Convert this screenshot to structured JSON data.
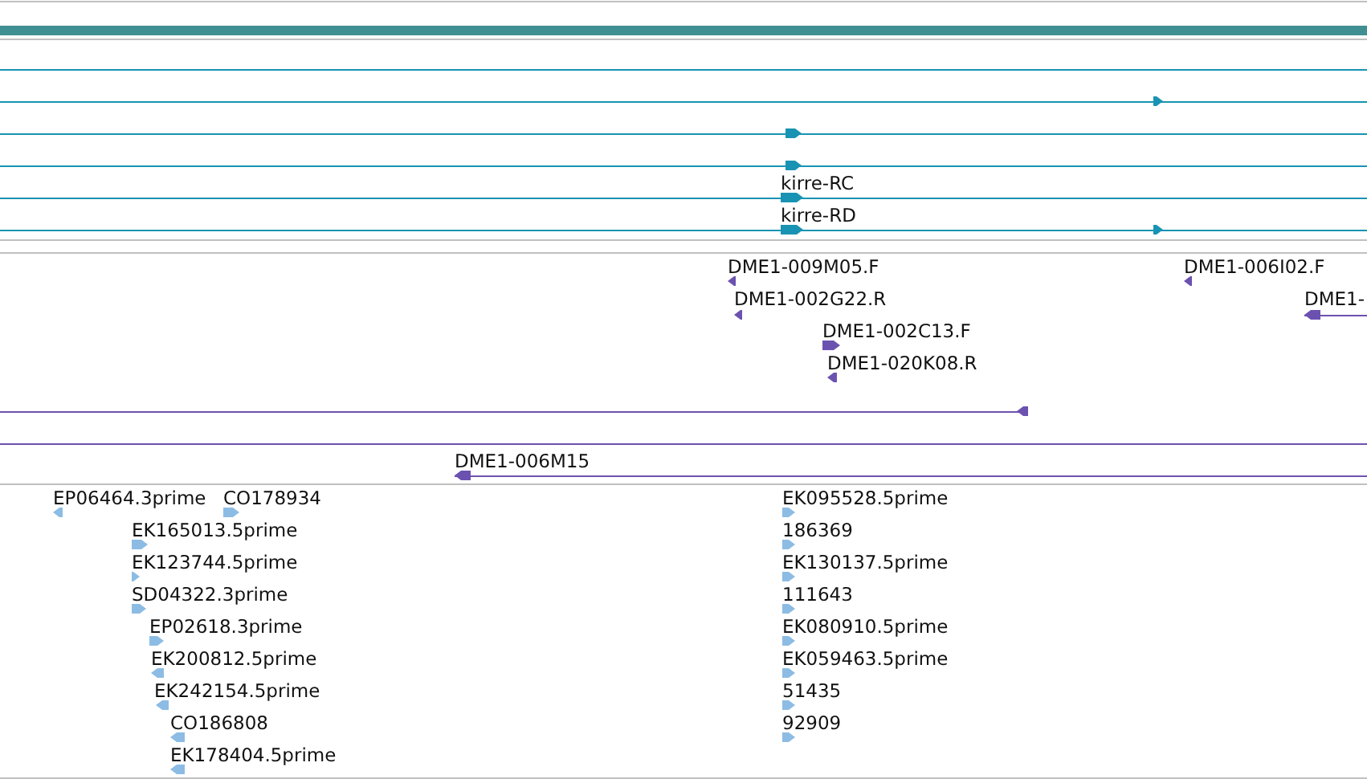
{
  "gene_track": {
    "transcripts": [
      {
        "kind": "line"
      },
      {
        "kind": "arrow",
        "reverse": false
      },
      {
        "kind": "arrow",
        "reverse": false
      },
      {
        "kind": "arrow",
        "reverse": false
      },
      {
        "kind": "arrow",
        "label": "kirre-RC",
        "reverse": false
      },
      {
        "kind": "arrow",
        "label": "kirre-RD",
        "reverse": false
      }
    ]
  },
  "clone_track": {
    "features": [
      {
        "kind": "arrow",
        "label": "DME1-009M05.F",
        "reverse": true
      },
      {
        "kind": "arrow",
        "label": "DME1-002G22.R",
        "reverse": true
      },
      {
        "kind": "arrow",
        "label": "DME1-002C13.F",
        "reverse": false
      },
      {
        "kind": "arrow",
        "label": "DME1-020K08.R",
        "reverse": true
      },
      {
        "kind": "arrow",
        "label": "DME1-006I02.F",
        "reverse": true
      },
      {
        "kind": "arrow",
        "label": "DME1-",
        "reverse": true
      },
      {
        "kind": "arrow",
        "reverse": true
      },
      {
        "kind": "line"
      },
      {
        "kind": "arrow",
        "label": "DME1-006M15",
        "reverse": true
      }
    ]
  },
  "est_track": {
    "features": [
      {
        "label": "EP06464.3prime",
        "reverse": true
      },
      {
        "label": "CO178934",
        "reverse": false
      },
      {
        "label": "EK165013.5prime",
        "reverse": false
      },
      {
        "label": "EK123744.5prime",
        "reverse": false
      },
      {
        "label": "SD04322.3prime",
        "reverse": false
      },
      {
        "label": "EP02618.3prime",
        "reverse": false
      },
      {
        "label": "EK200812.5prime",
        "reverse": true
      },
      {
        "label": "EK242154.5prime",
        "reverse": true
      },
      {
        "label": "CO186808",
        "reverse": true
      },
      {
        "label": "EK178404.5prime",
        "reverse": true
      },
      {
        "label": "EK095528.5prime",
        "reverse": false
      },
      {
        "label": "186369",
        "reverse": false
      },
      {
        "label": "EK130137.5prime",
        "reverse": false
      },
      {
        "label": "111643",
        "reverse": false
      },
      {
        "label": "EK080910.5prime",
        "reverse": false
      },
      {
        "label": "EK059463.5prime",
        "reverse": false
      },
      {
        "label": "51435",
        "reverse": false
      },
      {
        "label": "92909",
        "reverse": false
      }
    ]
  }
}
